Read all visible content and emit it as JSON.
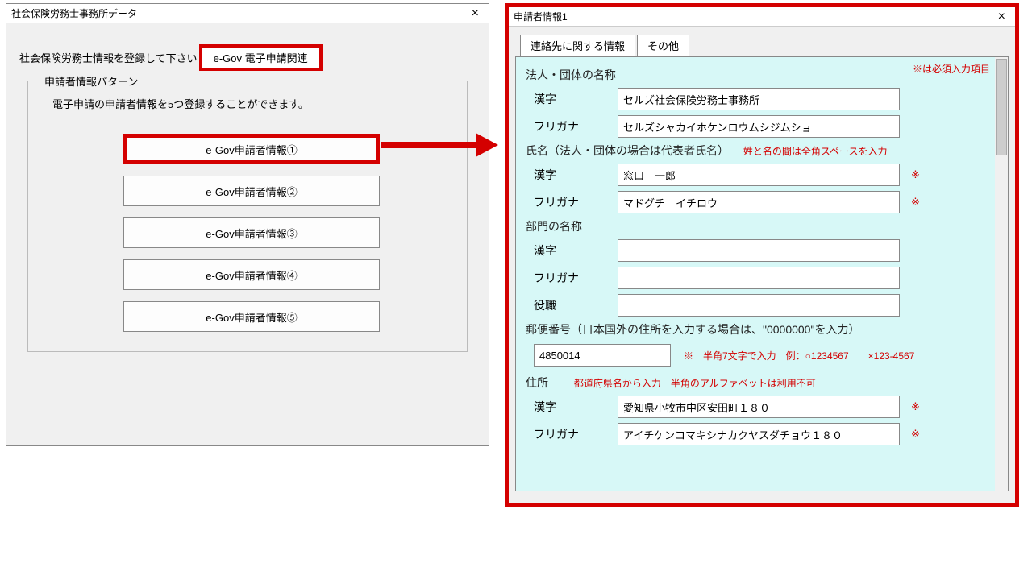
{
  "leftWindow": {
    "title": "社会保険労務士事務所データ",
    "instruction": "社会保険労務士情報を登録して下さい",
    "activeTab": "e-Gov 電子申請関連",
    "fieldset": {
      "legend": "申請者情報パターン",
      "desc": "電子申請の申請者情報を5つ登録することができます。",
      "buttons": [
        "e-Gov申請者情報①",
        "e-Gov申請者情報②",
        "e-Gov申請者情報③",
        "e-Gov申請者情報④",
        "e-Gov申請者情報⑤"
      ]
    }
  },
  "rightWindow": {
    "title": "申請者情報1",
    "tabs": [
      "連絡先に関する情報",
      "その他"
    ],
    "requiredNote": "※は必須入力項目",
    "sections": {
      "corp": {
        "heading": "法人・団体の名称",
        "kanji": {
          "label": "漢字",
          "value": "セルズ社会保険労務士事務所"
        },
        "kana": {
          "label": "フリガナ",
          "value": "セルズシャカイホケンロウムシジムショ"
        }
      },
      "person": {
        "heading": "氏名（法人・団体の場合は代表者氏名）",
        "hint": "姓と名の間は全角スペースを入力",
        "kanji": {
          "label": "漢字",
          "value": "窓口　一郎",
          "mark": "※"
        },
        "kana": {
          "label": "フリガナ",
          "value": "マドグチ　イチロウ",
          "mark": "※"
        }
      },
      "dept": {
        "heading": "部門の名称",
        "kanji": {
          "label": "漢字",
          "value": ""
        },
        "kana": {
          "label": "フリガナ",
          "value": ""
        },
        "title": {
          "label": "役職",
          "value": ""
        }
      },
      "postal": {
        "heading": "郵便番号（日本国外の住所を入力する場合は、\"0000000\"を入力）",
        "value": "4850014",
        "hint": "※　半角7文字で入力　例：○1234567　　×123-4567"
      },
      "addr": {
        "heading": "住所",
        "hint": "都道府県名から入力　半角のアルファベットは利用不可",
        "kanji": {
          "label": "漢字",
          "value": "愛知県小牧市中区安田町１８０",
          "mark": "※"
        },
        "kana": {
          "label": "フリガナ",
          "value": "アイチケンコマキシナカクヤスダチョウ１８０",
          "mark": "※"
        }
      }
    }
  },
  "glyphs": {
    "close": "×"
  }
}
